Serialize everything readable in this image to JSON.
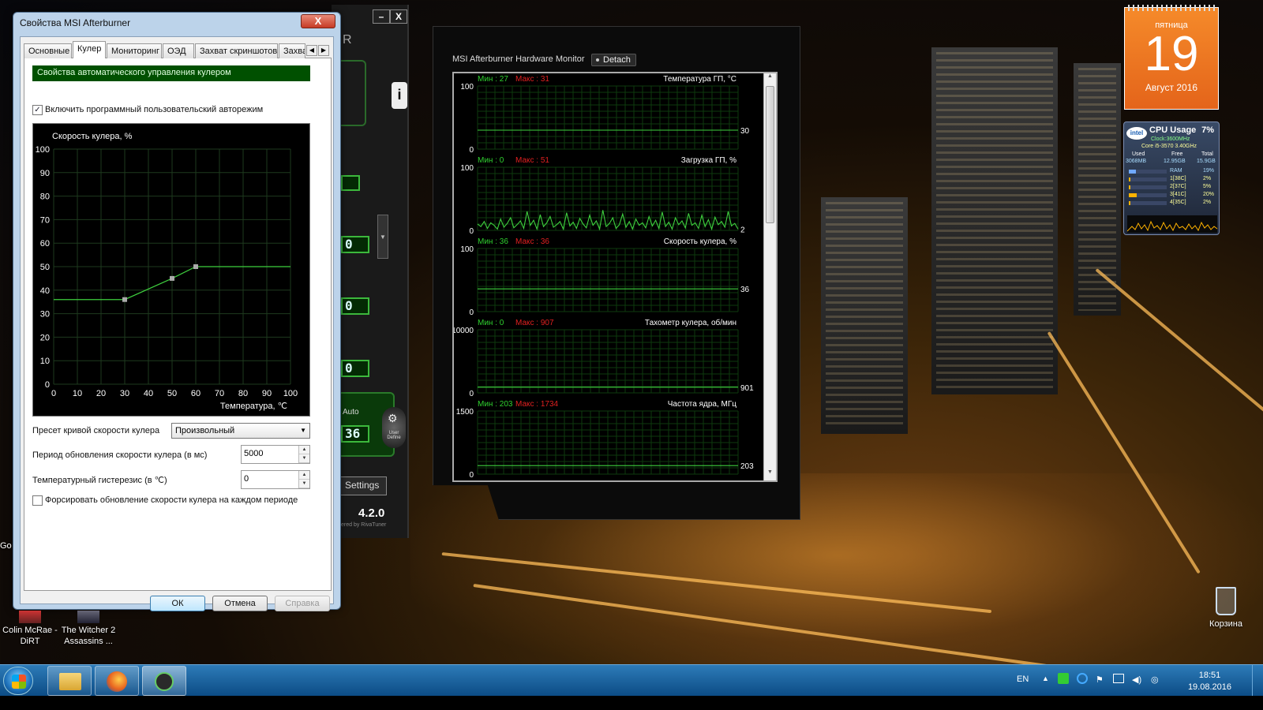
{
  "props_dialog": {
    "title": "Свойства MSI Afterburner",
    "close_label": "X",
    "tabs": [
      "Основные",
      "Кулер",
      "Мониторинг",
      "ОЭД",
      "Захват скриншотов",
      "Захва"
    ],
    "active_tab": 1,
    "section_header": "Свойства автоматического управления кулером",
    "auto_mode_label": "Включить программный пользовательский авторежим",
    "auto_mode_checked": true,
    "fan_curve": {
      "ylabel": "Скорость кулера, %",
      "xlabel": "Температура, ℃",
      "x_ticks": [
        "0",
        "10",
        "20",
        "30",
        "40",
        "50",
        "60",
        "70",
        "80",
        "90",
        "100"
      ],
      "y_ticks": [
        "100",
        "90",
        "80",
        "70",
        "60",
        "50",
        "40",
        "30",
        "20",
        "10",
        "0"
      ],
      "points": [
        {
          "x": 0,
          "y": 36
        },
        {
          "x": 30,
          "y": 36
        },
        {
          "x": 50,
          "y": 45
        },
        {
          "x": 60,
          "y": 50
        },
        {
          "x": 100,
          "y": 50
        }
      ],
      "xlim": [
        0,
        100
      ],
      "ylim": [
        0,
        100
      ],
      "grid": true,
      "line_color": "#3ecf3e"
    },
    "preset_label": "Пресет кривой скорости кулера",
    "preset_value": "Произвольный",
    "period_label": "Период обновления скорости кулера (в мс)",
    "period_value": "5000",
    "hysteresis_label": "Температурный гистерезис (в ℃)",
    "hysteresis_value": "0",
    "force_label": "Форсировать обновление скорости кулера на каждом периоде",
    "force_checked": false,
    "buttons": {
      "ok": "ОК",
      "cancel": "Отмена",
      "help": "Справка"
    }
  },
  "afterburner": {
    "values": [
      "0",
      "0",
      "0"
    ],
    "auto_label": "Auto",
    "fan_value": "36",
    "user_define": "User Define",
    "settings_label": "Settings",
    "version": "4.2.0",
    "powered_by": "ered by RivaTuner",
    "title_letter": "R"
  },
  "hw_monitor": {
    "title": "MSI Afterburner Hardware Monitor",
    "detach_label": "Detach",
    "graphs": [
      {
        "name": "Температура ГП, °С",
        "min": "Мин : 27",
        "max": "Макс : 31",
        "ymax": "100",
        "ymin": "0",
        "current": "30",
        "current_value": 30,
        "scale_max": 100,
        "data": [
          30,
          30,
          30,
          30,
          30,
          30,
          30,
          30,
          30,
          30,
          30,
          30,
          30,
          30,
          30,
          30,
          30,
          30,
          30,
          30
        ]
      },
      {
        "name": "Загрузка ГП, %",
        "min": "Мин : 0",
        "max": "Макс : 51",
        "ymax": "100",
        "ymin": "0",
        "current": "2",
        "current_value": 2,
        "scale_max": 100,
        "data": [
          10,
          6,
          14,
          3,
          12,
          8,
          2,
          18,
          5,
          11,
          20,
          4,
          9,
          15,
          3,
          30,
          8,
          16,
          2,
          25,
          6,
          12,
          22,
          5,
          9,
          14,
          2,
          28,
          7,
          13,
          3,
          19,
          10,
          4,
          24,
          8,
          15,
          2,
          32,
          6,
          11,
          20,
          3,
          9,
          26,
          5,
          14,
          2,
          18,
          8,
          12,
          4,
          22,
          7,
          16,
          3,
          29,
          6,
          13,
          2,
          20,
          9,
          15,
          4,
          27,
          8,
          12,
          3,
          24,
          6,
          17,
          2,
          21,
          9,
          14,
          5,
          30,
          7,
          11,
          2
        ]
      },
      {
        "name": "Скорость кулера, %",
        "min": "Мин : 36",
        "max": "Макс : 36",
        "ymax": "100",
        "ymin": "0",
        "current": "36",
        "current_value": 36,
        "scale_max": 100,
        "data": [
          36,
          36,
          36,
          36,
          36,
          36,
          36,
          36,
          36,
          36,
          36,
          36,
          36,
          36,
          36,
          36,
          36,
          36,
          36,
          36
        ]
      },
      {
        "name": "Тахометр кулера, об/мин",
        "min": "Мин : 0",
        "max": "Макс : 907",
        "ymax": "10000",
        "ymin": "0",
        "current": "901",
        "current_value": 901,
        "scale_max": 10000,
        "data": [
          901,
          901,
          901,
          901,
          901,
          901,
          901,
          901,
          901,
          901,
          901,
          901,
          901,
          901,
          901,
          901,
          901,
          901,
          901,
          901
        ]
      },
      {
        "name": "Частота ядра, МГц",
        "min": "Мин : 203",
        "max": "Макс : 1734",
        "ymax": "1500",
        "ymin": "0",
        "current": "203",
        "current_value": 203,
        "scale_max": 1500,
        "data": [
          203,
          203,
          203,
          203,
          203,
          203,
          203,
          203,
          203,
          203,
          203,
          203,
          203,
          203,
          203,
          203,
          203,
          203,
          203,
          203
        ]
      }
    ]
  },
  "calendar": {
    "weekday": "пятница",
    "day": "19",
    "month_year": "Август 2016"
  },
  "cpu_gadget": {
    "brand": "intel",
    "title": "CPU Usage",
    "usage": "7%",
    "clock": "Clock:3600MHz",
    "model": "Core i5-3570 3.40GHz",
    "mem_headers": [
      "Used",
      "Free",
      "Total"
    ],
    "mem_values": [
      "3068MB",
      "12.95GB",
      "15.9GB"
    ],
    "rows": [
      {
        "label": "RAM",
        "value": "19%",
        "level": 0.19
      },
      {
        "label": "1[38C]",
        "value": "2%",
        "level": 0.02
      },
      {
        "label": "2[37C]",
        "value": "5%",
        "level": 0.05
      },
      {
        "label": "3[41C]",
        "value": "20%",
        "level": 0.2
      },
      {
        "label": "4[35C]",
        "value": "2%",
        "level": 0.02
      }
    ]
  },
  "desktop_icons": [
    {
      "label": "Colin McRae - DiRT"
    },
    {
      "label": "The Witcher 2 Assassins ..."
    },
    {
      "label": "Корзина"
    }
  ],
  "partial_icon_label": "Go",
  "taskbar": {
    "lang": "EN",
    "time": "18:51",
    "date": "19.08.2016"
  },
  "colors": {
    "accent_green": "#3ecf3e",
    "min_green": "#2fd02f",
    "max_red": "#e02020",
    "header_green": "#005000"
  }
}
